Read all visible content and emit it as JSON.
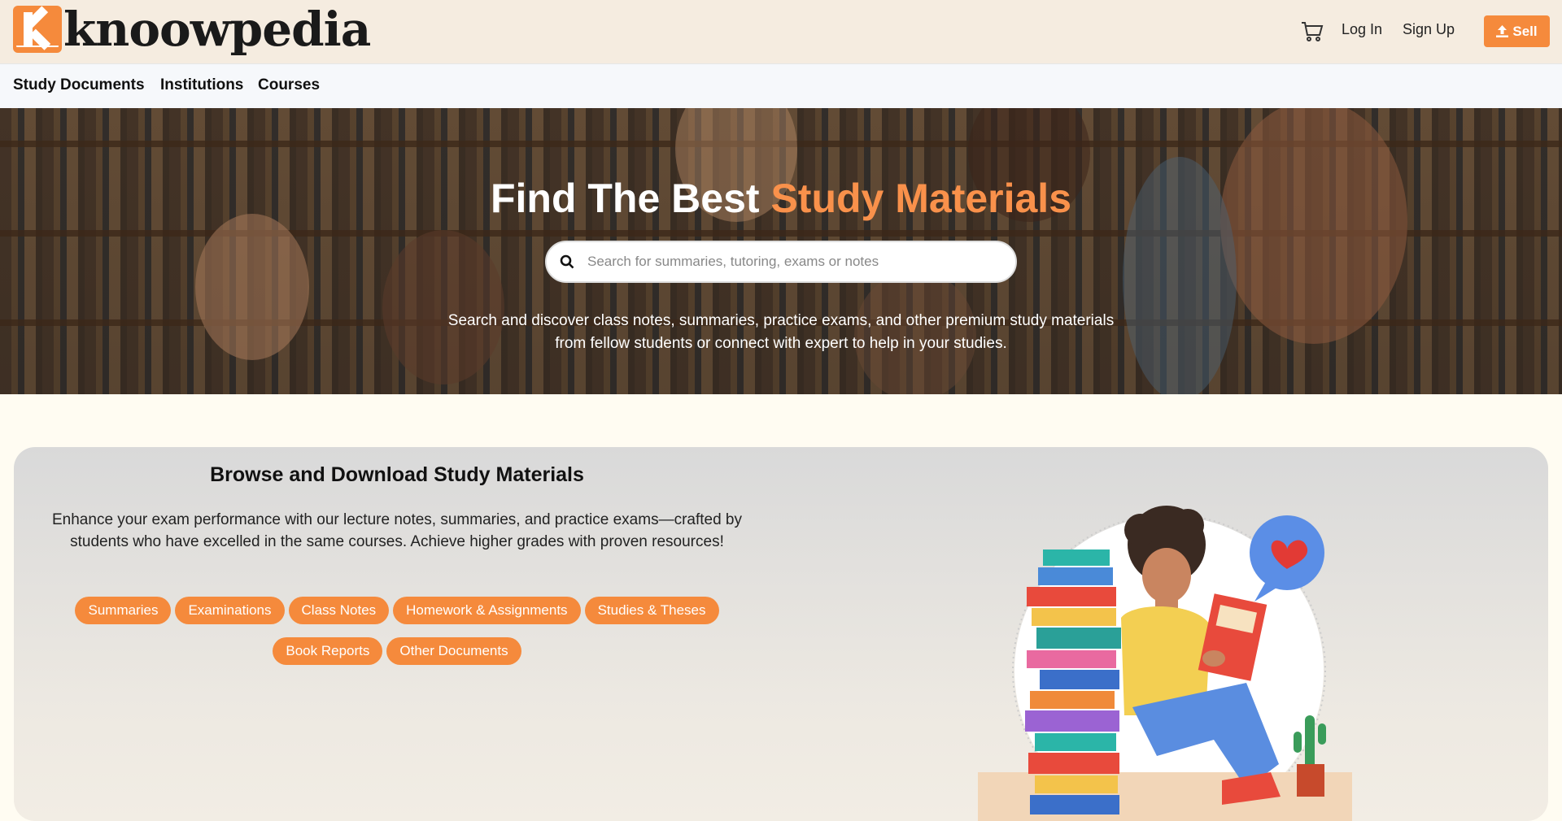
{
  "brand": {
    "logo_text": "knoowpedia",
    "logo_letter": "K"
  },
  "header": {
    "cart_icon": "cart-icon",
    "login_label": "Log In",
    "signup_label": "Sign Up",
    "sell_label": "Sell",
    "sell_icon": "upload-icon"
  },
  "subnav": {
    "items": [
      {
        "label": "Study Documents"
      },
      {
        "label": "Institutions"
      },
      {
        "label": "Courses"
      }
    ]
  },
  "hero": {
    "title_part1": "Find The Best ",
    "title_accent": "Study Materials",
    "search_placeholder": "Search for summaries, tutoring, exams or notes",
    "search_icon": "search-icon",
    "description": "Search and discover class notes, summaries, practice exams, and other premium study materials from fellow students or connect with expert to help in your studies."
  },
  "browse": {
    "title": "Browse and Download Study Materials",
    "description": "Enhance your exam performance with our lecture notes, summaries, and practice exams—crafted by students who have excelled in the same courses. Achieve higher grades with proven resources!",
    "tags": [
      "Summaries",
      "Examinations",
      "Class Notes",
      "Homework & Assignments",
      "Studies & Theses",
      "Book Reports",
      "Other Documents"
    ]
  },
  "colors": {
    "accent": "#f58a3c",
    "header_bg": "#f5ece0",
    "page_bg": "#fffcf2"
  }
}
